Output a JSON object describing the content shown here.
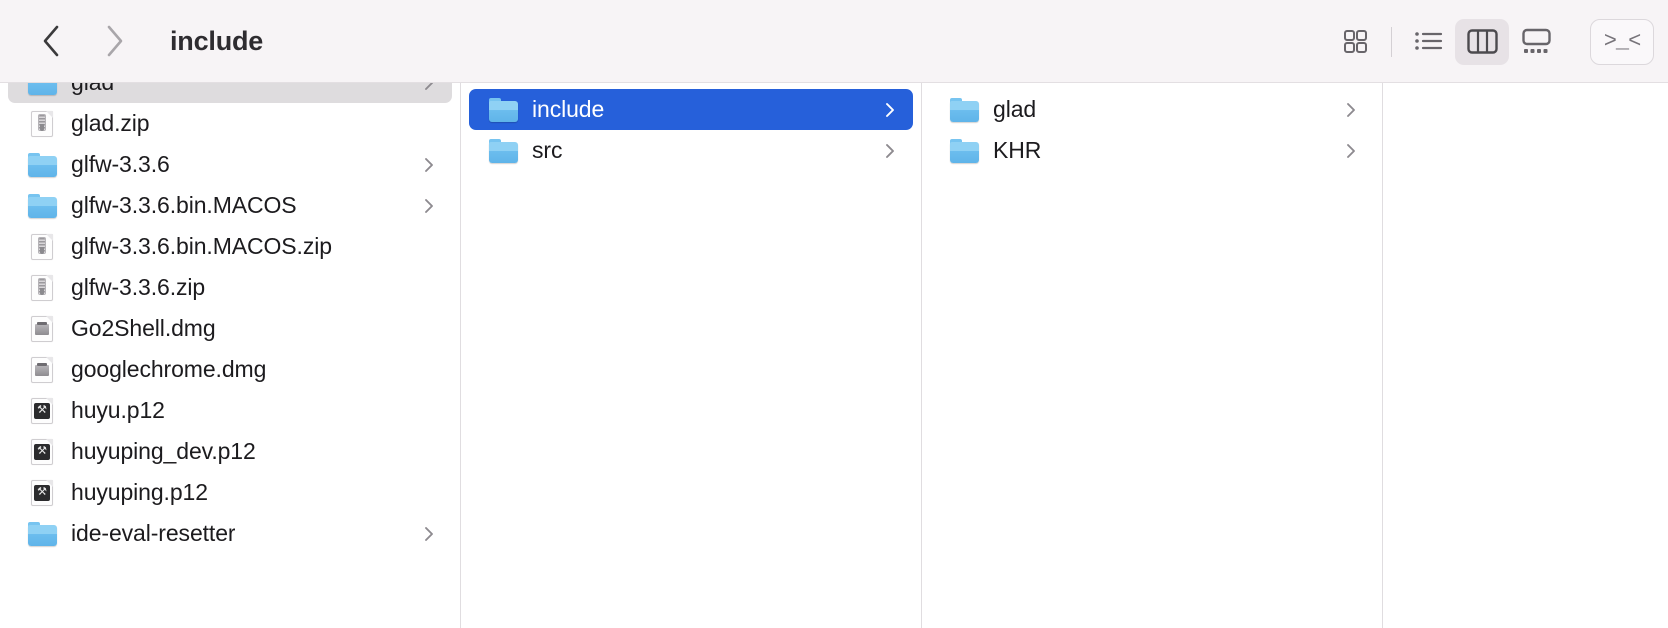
{
  "toolbar": {
    "back_label": "Back",
    "forward_label": "Forward",
    "title": "include",
    "back_icon": "chevron-left-icon",
    "forward_icon": "chevron-right-icon",
    "view_modes": [
      {
        "id": "icon",
        "label": "Icon View",
        "icon": "grid-view-icon",
        "active": false
      },
      {
        "id": "list",
        "label": "List View",
        "icon": "list-view-icon",
        "active": false
      },
      {
        "id": "column",
        "label": "Column View",
        "icon": "column-view-icon",
        "active": true
      },
      {
        "id": "gallery",
        "label": "Gallery View",
        "icon": "gallery-view-icon",
        "active": false
      }
    ],
    "shell_button": {
      "label": ">_<",
      "icon": "terminal-icon",
      "title": "Go2Shell"
    }
  },
  "colors": {
    "toolbar_bg": "#f7f4f6",
    "selection_active": "#2660da",
    "selection_inactive": "#dedcde",
    "folder_blue": "#8fd1f4",
    "text": "#1c1b1e",
    "divider": "#e0dde0"
  },
  "columns": [
    {
      "name": "column-1",
      "scrolled": true,
      "items": [
        {
          "label": "glad",
          "kind": "folder",
          "arrow": true,
          "selected": "inactive"
        },
        {
          "label": "glad.zip",
          "kind": "zip",
          "arrow": false,
          "selected": "none"
        },
        {
          "label": "glfw-3.3.6",
          "kind": "folder",
          "arrow": true,
          "selected": "none"
        },
        {
          "label": "glfw-3.3.6.bin.MACOS",
          "kind": "folder",
          "arrow": true,
          "selected": "none"
        },
        {
          "label": "glfw-3.3.6.bin.MACOS.zip",
          "kind": "zip",
          "arrow": false,
          "selected": "none"
        },
        {
          "label": "glfw-3.3.6.zip",
          "kind": "zip",
          "arrow": false,
          "selected": "none"
        },
        {
          "label": "Go2Shell.dmg",
          "kind": "dmg",
          "arrow": false,
          "selected": "none"
        },
        {
          "label": "googlechrome.dmg",
          "kind": "dmg",
          "arrow": false,
          "selected": "none"
        },
        {
          "label": "huyu.p12",
          "kind": "p12",
          "arrow": false,
          "selected": "none"
        },
        {
          "label": "huyuping_dev.p12",
          "kind": "p12",
          "arrow": false,
          "selected": "none"
        },
        {
          "label": "huyuping.p12",
          "kind": "p12",
          "arrow": false,
          "selected": "none"
        },
        {
          "label": "ide-eval-resetter",
          "kind": "folder",
          "arrow": true,
          "selected": "none"
        }
      ]
    },
    {
      "name": "column-2",
      "scrolled": false,
      "items": [
        {
          "label": "include",
          "kind": "folder",
          "arrow": true,
          "selected": "active"
        },
        {
          "label": "src",
          "kind": "folder",
          "arrow": true,
          "selected": "none"
        }
      ]
    },
    {
      "name": "column-3",
      "scrolled": false,
      "items": [
        {
          "label": "glad",
          "kind": "folder",
          "arrow": true,
          "selected": "none"
        },
        {
          "label": "KHR",
          "kind": "folder",
          "arrow": true,
          "selected": "none"
        }
      ]
    },
    {
      "name": "column-4",
      "scrolled": false,
      "items": []
    }
  ]
}
